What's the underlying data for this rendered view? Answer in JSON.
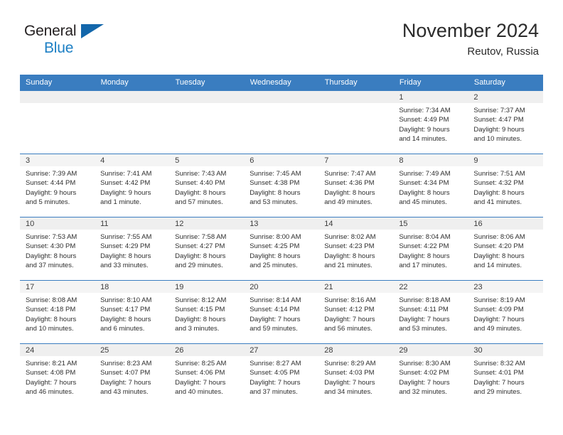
{
  "brand": {
    "name_part1": "General",
    "name_part2": "Blue"
  },
  "header": {
    "title": "November 2024",
    "location": "Reutov, Russia"
  },
  "colors": {
    "header_blue": "#3a7dc0",
    "logo_blue": "#1c7fc4",
    "daynum_band": "#efefef"
  },
  "weekday_headers": [
    "Sunday",
    "Monday",
    "Tuesday",
    "Wednesday",
    "Thursday",
    "Friday",
    "Saturday"
  ],
  "weeks": [
    {
      "days": [
        {
          "date": "",
          "sunrise": "",
          "sunset": "",
          "daylight1": "",
          "daylight2": ""
        },
        {
          "date": "",
          "sunrise": "",
          "sunset": "",
          "daylight1": "",
          "daylight2": ""
        },
        {
          "date": "",
          "sunrise": "",
          "sunset": "",
          "daylight1": "",
          "daylight2": ""
        },
        {
          "date": "",
          "sunrise": "",
          "sunset": "",
          "daylight1": "",
          "daylight2": ""
        },
        {
          "date": "",
          "sunrise": "",
          "sunset": "",
          "daylight1": "",
          "daylight2": ""
        },
        {
          "date": "1",
          "sunrise": "Sunrise: 7:34 AM",
          "sunset": "Sunset: 4:49 PM",
          "daylight1": "Daylight: 9 hours",
          "daylight2": "and 14 minutes."
        },
        {
          "date": "2",
          "sunrise": "Sunrise: 7:37 AM",
          "sunset": "Sunset: 4:47 PM",
          "daylight1": "Daylight: 9 hours",
          "daylight2": "and 10 minutes."
        }
      ]
    },
    {
      "days": [
        {
          "date": "3",
          "sunrise": "Sunrise: 7:39 AM",
          "sunset": "Sunset: 4:44 PM",
          "daylight1": "Daylight: 9 hours",
          "daylight2": "and 5 minutes."
        },
        {
          "date": "4",
          "sunrise": "Sunrise: 7:41 AM",
          "sunset": "Sunset: 4:42 PM",
          "daylight1": "Daylight: 9 hours",
          "daylight2": "and 1 minute."
        },
        {
          "date": "5",
          "sunrise": "Sunrise: 7:43 AM",
          "sunset": "Sunset: 4:40 PM",
          "daylight1": "Daylight: 8 hours",
          "daylight2": "and 57 minutes."
        },
        {
          "date": "6",
          "sunrise": "Sunrise: 7:45 AM",
          "sunset": "Sunset: 4:38 PM",
          "daylight1": "Daylight: 8 hours",
          "daylight2": "and 53 minutes."
        },
        {
          "date": "7",
          "sunrise": "Sunrise: 7:47 AM",
          "sunset": "Sunset: 4:36 PM",
          "daylight1": "Daylight: 8 hours",
          "daylight2": "and 49 minutes."
        },
        {
          "date": "8",
          "sunrise": "Sunrise: 7:49 AM",
          "sunset": "Sunset: 4:34 PM",
          "daylight1": "Daylight: 8 hours",
          "daylight2": "and 45 minutes."
        },
        {
          "date": "9",
          "sunrise": "Sunrise: 7:51 AM",
          "sunset": "Sunset: 4:32 PM",
          "daylight1": "Daylight: 8 hours",
          "daylight2": "and 41 minutes."
        }
      ]
    },
    {
      "days": [
        {
          "date": "10",
          "sunrise": "Sunrise: 7:53 AM",
          "sunset": "Sunset: 4:30 PM",
          "daylight1": "Daylight: 8 hours",
          "daylight2": "and 37 minutes."
        },
        {
          "date": "11",
          "sunrise": "Sunrise: 7:55 AM",
          "sunset": "Sunset: 4:29 PM",
          "daylight1": "Daylight: 8 hours",
          "daylight2": "and 33 minutes."
        },
        {
          "date": "12",
          "sunrise": "Sunrise: 7:58 AM",
          "sunset": "Sunset: 4:27 PM",
          "daylight1": "Daylight: 8 hours",
          "daylight2": "and 29 minutes."
        },
        {
          "date": "13",
          "sunrise": "Sunrise: 8:00 AM",
          "sunset": "Sunset: 4:25 PM",
          "daylight1": "Daylight: 8 hours",
          "daylight2": "and 25 minutes."
        },
        {
          "date": "14",
          "sunrise": "Sunrise: 8:02 AM",
          "sunset": "Sunset: 4:23 PM",
          "daylight1": "Daylight: 8 hours",
          "daylight2": "and 21 minutes."
        },
        {
          "date": "15",
          "sunrise": "Sunrise: 8:04 AM",
          "sunset": "Sunset: 4:22 PM",
          "daylight1": "Daylight: 8 hours",
          "daylight2": "and 17 minutes."
        },
        {
          "date": "16",
          "sunrise": "Sunrise: 8:06 AM",
          "sunset": "Sunset: 4:20 PM",
          "daylight1": "Daylight: 8 hours",
          "daylight2": "and 14 minutes."
        }
      ]
    },
    {
      "days": [
        {
          "date": "17",
          "sunrise": "Sunrise: 8:08 AM",
          "sunset": "Sunset: 4:18 PM",
          "daylight1": "Daylight: 8 hours",
          "daylight2": "and 10 minutes."
        },
        {
          "date": "18",
          "sunrise": "Sunrise: 8:10 AM",
          "sunset": "Sunset: 4:17 PM",
          "daylight1": "Daylight: 8 hours",
          "daylight2": "and 6 minutes."
        },
        {
          "date": "19",
          "sunrise": "Sunrise: 8:12 AM",
          "sunset": "Sunset: 4:15 PM",
          "daylight1": "Daylight: 8 hours",
          "daylight2": "and 3 minutes."
        },
        {
          "date": "20",
          "sunrise": "Sunrise: 8:14 AM",
          "sunset": "Sunset: 4:14 PM",
          "daylight1": "Daylight: 7 hours",
          "daylight2": "and 59 minutes."
        },
        {
          "date": "21",
          "sunrise": "Sunrise: 8:16 AM",
          "sunset": "Sunset: 4:12 PM",
          "daylight1": "Daylight: 7 hours",
          "daylight2": "and 56 minutes."
        },
        {
          "date": "22",
          "sunrise": "Sunrise: 8:18 AM",
          "sunset": "Sunset: 4:11 PM",
          "daylight1": "Daylight: 7 hours",
          "daylight2": "and 53 minutes."
        },
        {
          "date": "23",
          "sunrise": "Sunrise: 8:19 AM",
          "sunset": "Sunset: 4:09 PM",
          "daylight1": "Daylight: 7 hours",
          "daylight2": "and 49 minutes."
        }
      ]
    },
    {
      "days": [
        {
          "date": "24",
          "sunrise": "Sunrise: 8:21 AM",
          "sunset": "Sunset: 4:08 PM",
          "daylight1": "Daylight: 7 hours",
          "daylight2": "and 46 minutes."
        },
        {
          "date": "25",
          "sunrise": "Sunrise: 8:23 AM",
          "sunset": "Sunset: 4:07 PM",
          "daylight1": "Daylight: 7 hours",
          "daylight2": "and 43 minutes."
        },
        {
          "date": "26",
          "sunrise": "Sunrise: 8:25 AM",
          "sunset": "Sunset: 4:06 PM",
          "daylight1": "Daylight: 7 hours",
          "daylight2": "and 40 minutes."
        },
        {
          "date": "27",
          "sunrise": "Sunrise: 8:27 AM",
          "sunset": "Sunset: 4:05 PM",
          "daylight1": "Daylight: 7 hours",
          "daylight2": "and 37 minutes."
        },
        {
          "date": "28",
          "sunrise": "Sunrise: 8:29 AM",
          "sunset": "Sunset: 4:03 PM",
          "daylight1": "Daylight: 7 hours",
          "daylight2": "and 34 minutes."
        },
        {
          "date": "29",
          "sunrise": "Sunrise: 8:30 AM",
          "sunset": "Sunset: 4:02 PM",
          "daylight1": "Daylight: 7 hours",
          "daylight2": "and 32 minutes."
        },
        {
          "date": "30",
          "sunrise": "Sunrise: 8:32 AM",
          "sunset": "Sunset: 4:01 PM",
          "daylight1": "Daylight: 7 hours",
          "daylight2": "and 29 minutes."
        }
      ]
    }
  ]
}
